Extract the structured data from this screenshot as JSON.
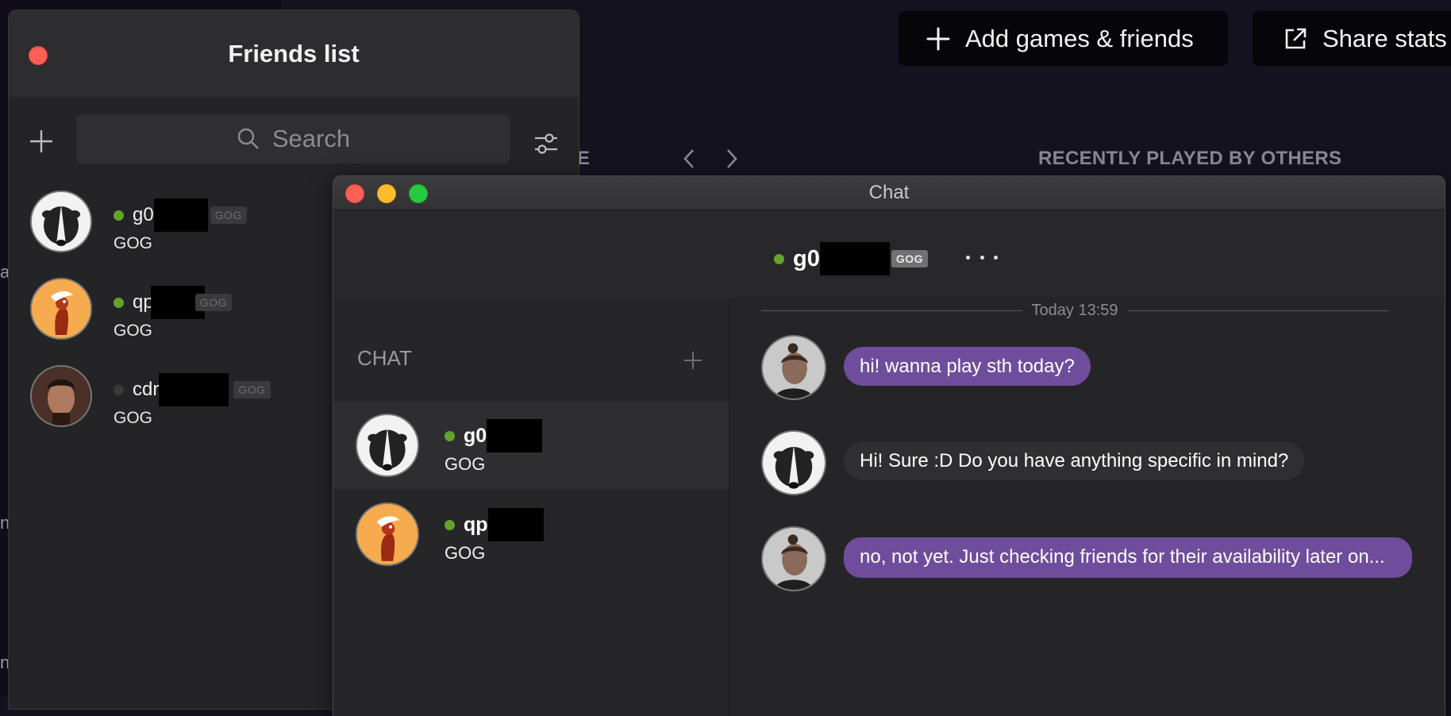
{
  "background": {
    "add_button_label": "Add games & friends",
    "share_button_label": "Share stats",
    "section_left_label": "IE",
    "section_right_label": "RECENTLY PLAYED BY OTHERS",
    "edge_letters": [
      "a",
      "n",
      "n"
    ]
  },
  "friends_window": {
    "title": "Friends list",
    "search_placeholder": "Search",
    "friends": [
      {
        "name": "g0",
        "platform_tag": "GOG",
        "status": "online",
        "subtitle": "GOG",
        "avatar": "badger"
      },
      {
        "name": "qp",
        "platform_tag": "GOG",
        "status": "online",
        "subtitle": "GOG",
        "avatar": "bird"
      },
      {
        "name": "cdr",
        "platform_tag": "GOG",
        "status": "offline",
        "subtitle": "GOG",
        "avatar": "man-portrait"
      }
    ]
  },
  "chat_window": {
    "title": "Chat",
    "header": {
      "name": "g0",
      "platform_tag": "GOG",
      "status": "online"
    },
    "conversations_label": "CHAT",
    "conversations": [
      {
        "name": "g0",
        "subtitle": "GOG",
        "status": "online",
        "active": true,
        "avatar": "badger"
      },
      {
        "name": "qp",
        "subtitle": "GOG",
        "status": "online",
        "active": false,
        "avatar": "bird"
      }
    ],
    "day_separator": "Today 13:59",
    "messages": [
      {
        "from": "me",
        "avatar": "man-with-bun",
        "text": "hi! wanna play sth today?"
      },
      {
        "from": "them",
        "avatar": "badger",
        "text": "Hi! Sure :D Do you have anything specific in mind?"
      },
      {
        "from": "me",
        "avatar": "man-with-bun",
        "text": "no, not yet. Just checking friends for their availability later on..."
      }
    ]
  },
  "colors": {
    "online": "#64a32a",
    "my_bubble": "#6f4d9c",
    "their_bubble": "#2f2f31",
    "window_bg": "#242426"
  }
}
